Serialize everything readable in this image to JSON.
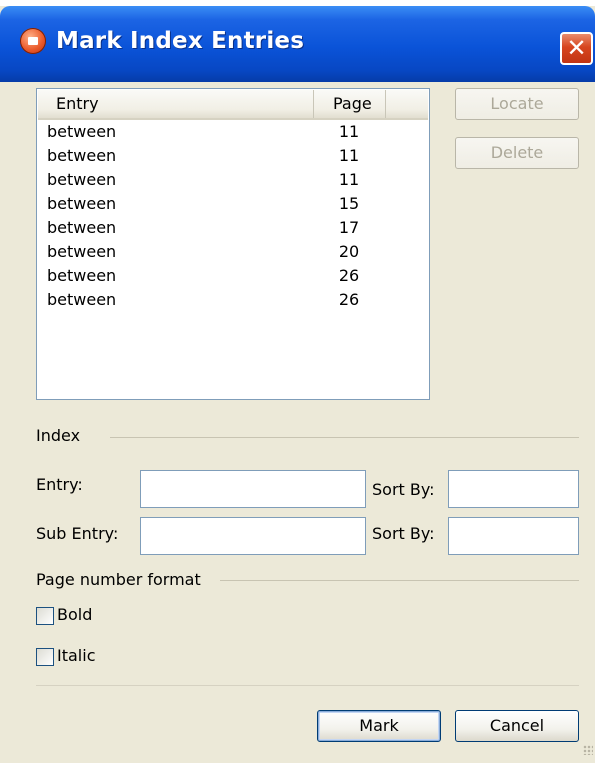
{
  "window": {
    "title": "Mark Index Entries",
    "icon": "app-icon",
    "close_glyph": "✕"
  },
  "list": {
    "columns": [
      "Entry",
      "Page"
    ],
    "rows": [
      {
        "entry": "between",
        "page": "11"
      },
      {
        "entry": "between",
        "page": "11"
      },
      {
        "entry": "between",
        "page": "11"
      },
      {
        "entry": "between",
        "page": "15"
      },
      {
        "entry": "between",
        "page": "17"
      },
      {
        "entry": "between",
        "page": "20"
      },
      {
        "entry": "between",
        "page": "26"
      },
      {
        "entry": "between",
        "page": "26"
      }
    ]
  },
  "side_buttons": {
    "locate": "Locate",
    "delete": "Delete"
  },
  "index": {
    "section_label": "Index",
    "entry_label": "Entry:",
    "entry_value": "",
    "sort_by_label": "Sort By:",
    "sort_by_value": "",
    "sub_entry_label": "Sub Entry:",
    "sub_entry_value": "",
    "sub_sort_by_label": "Sort By:",
    "sub_sort_by_value": ""
  },
  "page_number_format": {
    "section_label": "Page number format",
    "bold_label": "Bold",
    "bold_checked": false,
    "italic_label": "Italic",
    "italic_checked": false
  },
  "actions": {
    "mark": "Mark",
    "cancel": "Cancel"
  },
  "colors": {
    "titlebar": "#0a53d8",
    "dialog_bg": "#ece9d8",
    "close_button": "#d7461f"
  }
}
